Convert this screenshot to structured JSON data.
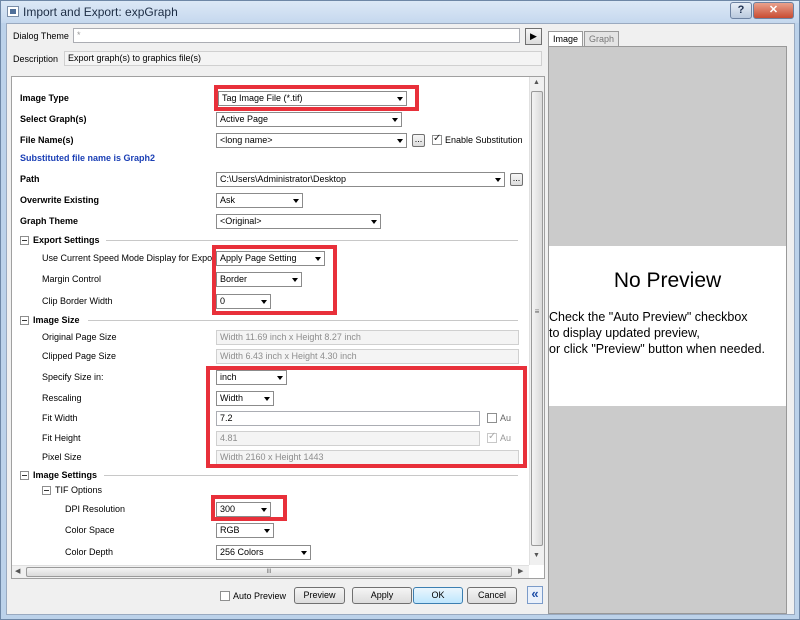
{
  "window": {
    "title": "Import and Export: expGraph",
    "help_label": "?",
    "close_label": "✕"
  },
  "header": {
    "dialog_theme_label": "Dialog Theme",
    "dialog_theme_value": "*",
    "nav_arrow": "▶",
    "description_label": "Description",
    "description_value": "Export graph(s) to graphics file(s)"
  },
  "settings": {
    "image_type_label": "Image Type",
    "image_type_value": "Tag Image File (*.tif)",
    "select_graphs_label": "Select Graph(s)",
    "select_graphs_value": "Active Page",
    "file_names_label": "File Name(s)",
    "file_names_value": "<long name>",
    "enable_substitution_label": "Enable Substitution",
    "substituted_note": "Substituted file name is Graph2",
    "path_label": "Path",
    "path_value": "C:\\Users\\Administrator\\Desktop",
    "overwrite_label": "Overwrite Existing",
    "overwrite_value": "Ask",
    "graph_theme_label": "Graph Theme",
    "graph_theme_value": "<Original>",
    "browse_label": "..."
  },
  "export_settings": {
    "title": "Export Settings",
    "speed_mode_label": "Use Current Speed Mode Display for Expor",
    "speed_mode_value": "Apply Page Setting",
    "margin_label": "Margin Control",
    "margin_value": "Border",
    "clip_label": "Clip Border Width",
    "clip_value": "0"
  },
  "image_size": {
    "title": "Image Size",
    "original_label": "Original Page Size",
    "original_value": "Width 11.69 inch x Height 8.27 inch",
    "clipped_label": "Clipped Page Size",
    "clipped_value": "Width 6.43 inch x Height 4.30 inch",
    "specify_label": "Specify Size in:",
    "specify_value": "inch",
    "rescaling_label": "Rescaling",
    "rescaling_value": "Width",
    "fit_width_label": "Fit Width",
    "fit_width_value": "7.2",
    "auto_label_1": "Au",
    "fit_height_label": "Fit Height",
    "fit_height_value": "4.81",
    "auto_label_2": "Au",
    "pixel_label": "Pixel Size",
    "pixel_value": "Width 2160 x Height 1443"
  },
  "image_settings": {
    "title": "Image Settings",
    "tif_options": "TIF Options",
    "dpi_label": "DPI Resolution",
    "dpi_value": "300",
    "color_space_label": "Color Space",
    "color_space_value": "RGB",
    "color_depth_label": "Color Depth",
    "color_depth_value": "256 Colors"
  },
  "scroll": {
    "grip": "≡",
    "hgrip": "III",
    "up": "▲",
    "down": "▼",
    "left": "◀",
    "right": "▶"
  },
  "footer": {
    "auto_preview_label": "Auto Preview",
    "preview_label": "Preview",
    "apply_label": "Apply",
    "ok_label": "OK",
    "cancel_label": "Cancel",
    "collapse_label": "«"
  },
  "preview": {
    "tab_image": "Image",
    "tab_graph": "Graph",
    "title": "No Preview",
    "line1": "Check the \"Auto Preview\" checkbox",
    "line2": "to display updated preview,",
    "line3": "or click \"Preview\" button when needed."
  },
  "colors": {
    "highlight_box": "#e8303a",
    "substituted_text": "#1a3fb5"
  }
}
